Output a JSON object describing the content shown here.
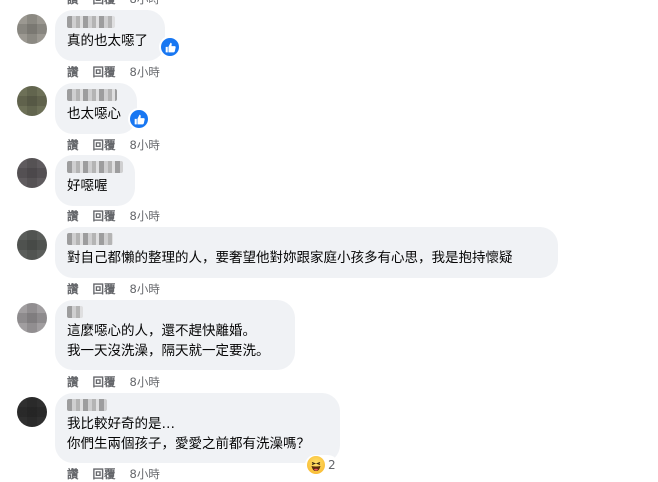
{
  "actions": {
    "like": "讚",
    "reply": "回覆"
  },
  "comments": [
    {
      "text": "真的也太噁了",
      "time": "8小時"
    },
    {
      "text": "也太噁心",
      "time": "8小時"
    },
    {
      "text": "好噁喔",
      "time": "8小時"
    },
    {
      "text": "對自己都懶的整理的人，要奢望他對妳跟家庭小孩多有心思，我是抱持懷疑",
      "time": "8小時"
    },
    {
      "lines": [
        "這麼噁心的人，還不趕快離婚。",
        "我一天沒洗澡，隔天就一定要洗。"
      ],
      "time": "8小時"
    },
    {
      "lines": [
        "我比較好奇的是…",
        "你們生兩個孩子，愛愛之前都有洗澡嗎？"
      ],
      "time": "8小時",
      "reaction_count": "2"
    }
  ],
  "colors": {
    "bubble": "#f0f2f5",
    "meta": "#65676b",
    "like_blue": "#1877f2"
  },
  "icons": {
    "like": "thumbs-up-icon",
    "haha": "haha-emoji-icon"
  }
}
